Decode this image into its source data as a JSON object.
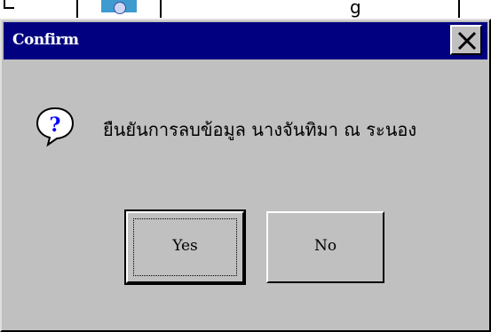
{
  "dialog": {
    "title": "Confirm",
    "message": "ยืนยันการลบข้อมูล นางจันทิมา ณ ระนอง",
    "icon": "question-icon",
    "buttons": {
      "yes_label": "Yes",
      "no_label": "No"
    }
  },
  "colors": {
    "titlebar": "#000080",
    "face": "#c0c0c0"
  }
}
